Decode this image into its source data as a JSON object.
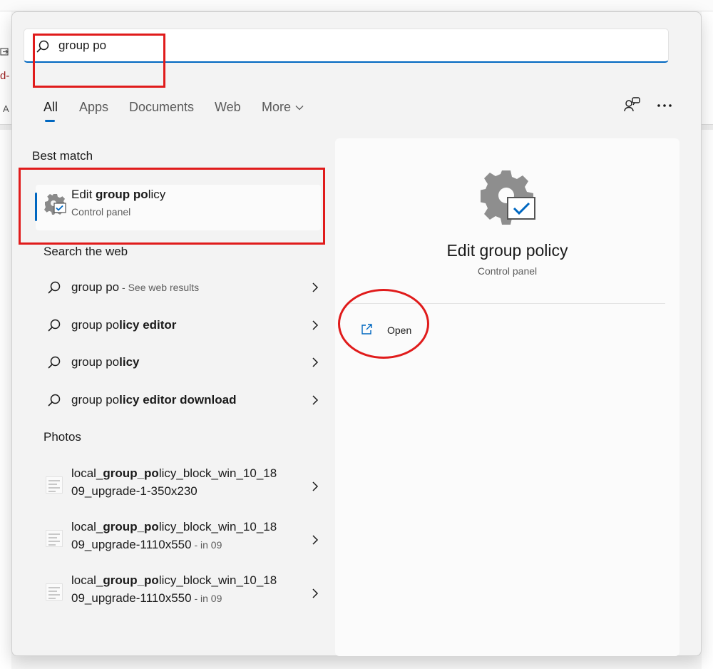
{
  "background_app": {
    "fragment_1": "d-",
    "fragment_2": "A"
  },
  "search": {
    "query": "group po",
    "placeholder": ""
  },
  "tabs": [
    {
      "label": "All",
      "active": true
    },
    {
      "label": "Apps",
      "active": false
    },
    {
      "label": "Documents",
      "active": false
    },
    {
      "label": "Web",
      "active": false
    },
    {
      "label": "More",
      "active": false
    }
  ],
  "toolbar": {
    "share_icon": "people-share-icon",
    "more_icon": "ellipsis-icon"
  },
  "best_match": {
    "section_title": "Best match",
    "title_pre": "Edit ",
    "title_bold": "group po",
    "title_post": "licy",
    "subtitle": "Control panel",
    "icon": "settings-gear-check-icon"
  },
  "web": {
    "section_title": "Search the web",
    "items": [
      {
        "normal": "group po",
        "bold": "",
        "hint": " - See web results"
      },
      {
        "normal": "group po",
        "bold": "licy editor",
        "hint": ""
      },
      {
        "normal": "group po",
        "bold": "licy",
        "hint": ""
      },
      {
        "normal": "group po",
        "bold": "licy editor download",
        "hint": ""
      }
    ]
  },
  "photos": {
    "section_title": "Photos",
    "items": [
      {
        "line1_a": "local_",
        "line1_b": "group_po",
        "line1_c": "licy_block_win_10_18",
        "line2": "09_upgrade-1-350x230",
        "hint": ""
      },
      {
        "line1_a": "local_",
        "line1_b": "group_po",
        "line1_c": "licy_block_win_10_18",
        "line2": "09_upgrade-1110x550",
        "hint": " - in 09"
      },
      {
        "line1_a": "local_",
        "line1_b": "group_po",
        "line1_c": "licy_block_win_10_18",
        "line2": "09_upgrade-1110x550",
        "hint": " - in 09"
      }
    ]
  },
  "detail": {
    "title": "Edit group policy",
    "subtitle": "Control panel",
    "actions": [
      {
        "label": "Open",
        "icon": "open-external-icon"
      }
    ]
  },
  "colors": {
    "accent": "#0067c0",
    "annotation": "#e01b1b",
    "panel_bg": "#f3f3f3"
  }
}
